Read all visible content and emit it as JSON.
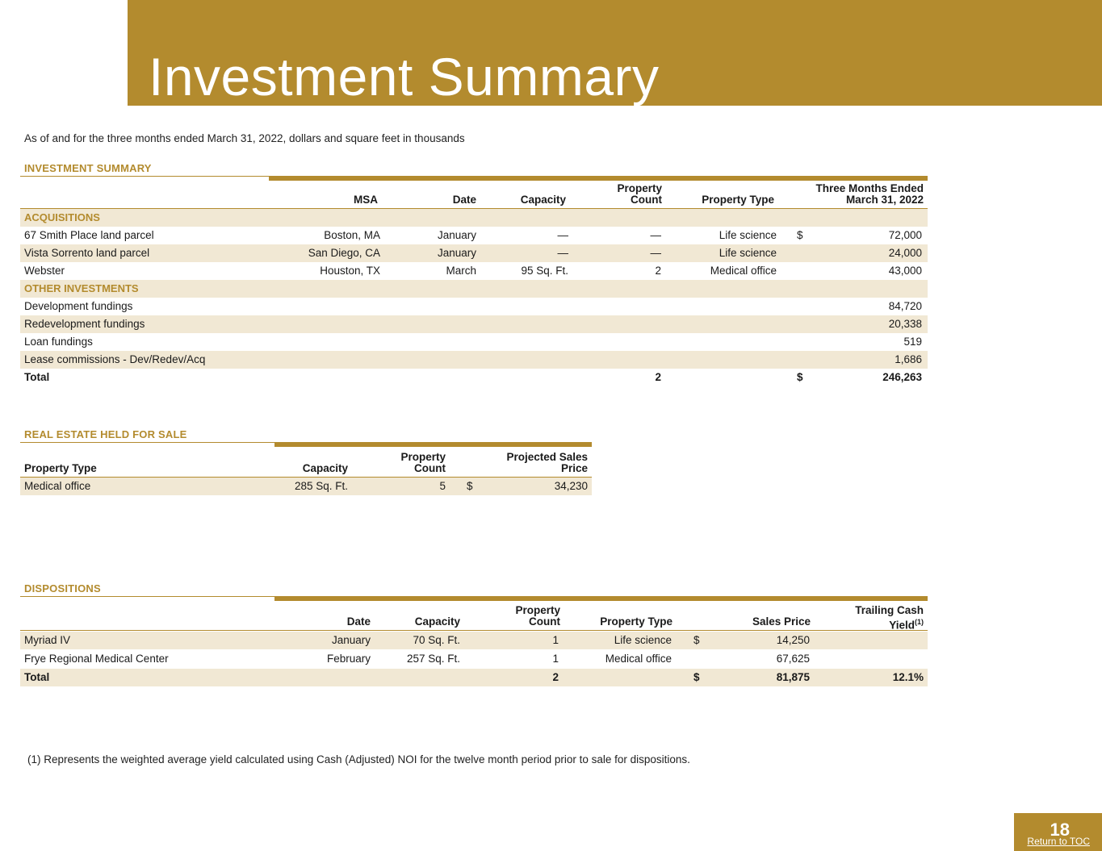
{
  "page": {
    "title": "Investment Summary",
    "subtitle": "As of and for the three months ended March 31, 2022, dollars and square feet in thousands",
    "page_number": "18",
    "return_link": "Return to TOC",
    "footnote": "(1)    Represents the weighted average yield calculated using Cash (Adjusted) NOI for the twelve month period prior to sale for dispositions.",
    "accent_color": "#b38b2e",
    "shade_color": "#f1e8d4"
  },
  "investment": {
    "section_title": "INVESTMENT SUMMARY",
    "headers": {
      "msa": "MSA",
      "date": "Date",
      "capacity": "Capacity",
      "count_1": "Property",
      "count_2": "Count",
      "type": "Property Type",
      "period_1": "Three Months Ended",
      "period_2": "March 31, 2022"
    },
    "acquisitions_label": "ACQUISITIONS",
    "acquisitions": [
      {
        "name": "67 Smith Place land parcel",
        "msa": "Boston, MA",
        "date": "January",
        "capacity": "—",
        "count": "—",
        "type": "Life science",
        "cur": "$",
        "amount": "72,000"
      },
      {
        "name": "Vista Sorrento land parcel",
        "msa": "San Diego, CA",
        "date": "January",
        "capacity": "—",
        "count": "—",
        "type": "Life science",
        "cur": "",
        "amount": "24,000"
      },
      {
        "name": "Webster",
        "msa": "Houston, TX",
        "date": "March",
        "capacity": "95 Sq. Ft.",
        "count": "2",
        "type": "Medical office",
        "cur": "",
        "amount": "43,000"
      }
    ],
    "other_label": "OTHER INVESTMENTS",
    "other": [
      {
        "name": "Development fundings",
        "amount": "84,720"
      },
      {
        "name": "Redevelopment fundings",
        "amount": "20,338"
      },
      {
        "name": "Loan fundings",
        "amount": "519"
      },
      {
        "name": "Lease commissions - Dev/Redev/Acq",
        "amount": "1,686"
      }
    ],
    "total": {
      "label": "Total",
      "count": "2",
      "cur": "$",
      "amount": "246,263"
    }
  },
  "held_for_sale": {
    "section_title": "REAL ESTATE HELD FOR SALE",
    "headers": {
      "type": "Property Type",
      "capacity": "Capacity",
      "count_1": "Property",
      "count_2": "Count",
      "price_1": "Projected Sales",
      "price_2": "Price"
    },
    "rows": [
      {
        "type": "Medical office",
        "capacity": "285 Sq. Ft.",
        "count": "5",
        "cur": "$",
        "price": "34,230"
      }
    ]
  },
  "dispositions": {
    "section_title": "DISPOSITIONS",
    "headers": {
      "date": "Date",
      "capacity": "Capacity",
      "count_1": "Property",
      "count_2": "Count",
      "type": "Property Type",
      "price": "Sales Price",
      "yield_1": "Trailing Cash",
      "yield_2": "Yield",
      "yield_sup": "(1)"
    },
    "rows": [
      {
        "name": "Myriad IV",
        "date": "January",
        "capacity": "70 Sq. Ft.",
        "count": "1",
        "type": "Life science",
        "cur": "$",
        "price": "14,250"
      },
      {
        "name": "Frye Regional Medical Center",
        "date": "February",
        "capacity": "257 Sq. Ft.",
        "count": "1",
        "type": "Medical office",
        "cur": "",
        "price": "67,625"
      }
    ],
    "total": {
      "label": "Total",
      "count": "2",
      "cur": "$",
      "price": "81,875",
      "yield": "12.1%"
    }
  }
}
